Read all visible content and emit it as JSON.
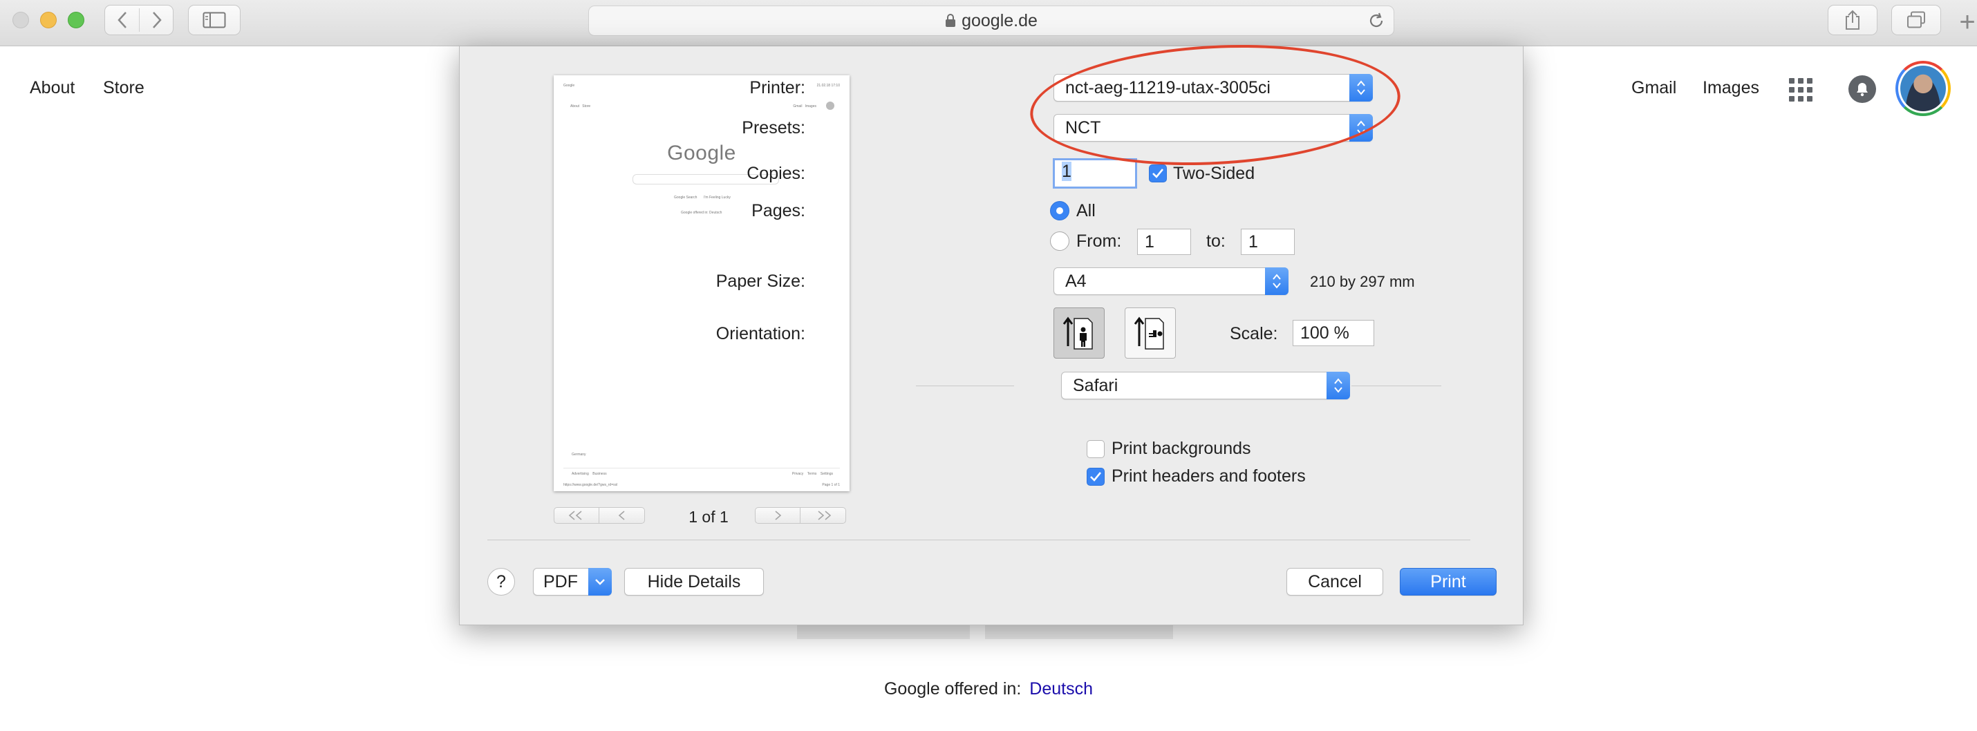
{
  "browser": {
    "url": "google.de"
  },
  "google": {
    "about": "About",
    "store": "Store",
    "gmail": "Gmail",
    "images": "Images",
    "offered_in": "Google offered in:",
    "offered_lang": "Deutsch"
  },
  "preview": {
    "logo": "Google",
    "page_count": "1 of 1"
  },
  "print_dialog": {
    "printer_label": "Printer:",
    "printer_value": "nct-aeg-11219-utax-3005ci",
    "presets_label": "Presets:",
    "presets_value": "NCT",
    "copies_label": "Copies:",
    "copies_value": "1",
    "two_sided_label": "Two-Sided",
    "two_sided_checked": true,
    "pages_label": "Pages:",
    "pages_all_label": "All",
    "pages_from_label": "From:",
    "pages_from_value": "1",
    "pages_to_label": "to:",
    "pages_to_value": "1",
    "paper_size_label": "Paper Size:",
    "paper_size_value": "A4",
    "paper_size_dims": "210 by 297 mm",
    "orientation_label": "Orientation:",
    "scale_label": "Scale:",
    "scale_value": "100 %",
    "app_section_value": "Safari",
    "print_backgrounds_label": "Print backgrounds",
    "print_backgrounds_checked": false,
    "print_headers_label": "Print headers and footers",
    "print_headers_checked": true,
    "help_label": "?",
    "pdf_label": "PDF",
    "hide_details_label": "Hide Details",
    "cancel_label": "Cancel",
    "print_label": "Print"
  },
  "colors": {
    "accent": "#3a85f4",
    "annotation": "#e0452e",
    "link": "#1a0dab"
  }
}
